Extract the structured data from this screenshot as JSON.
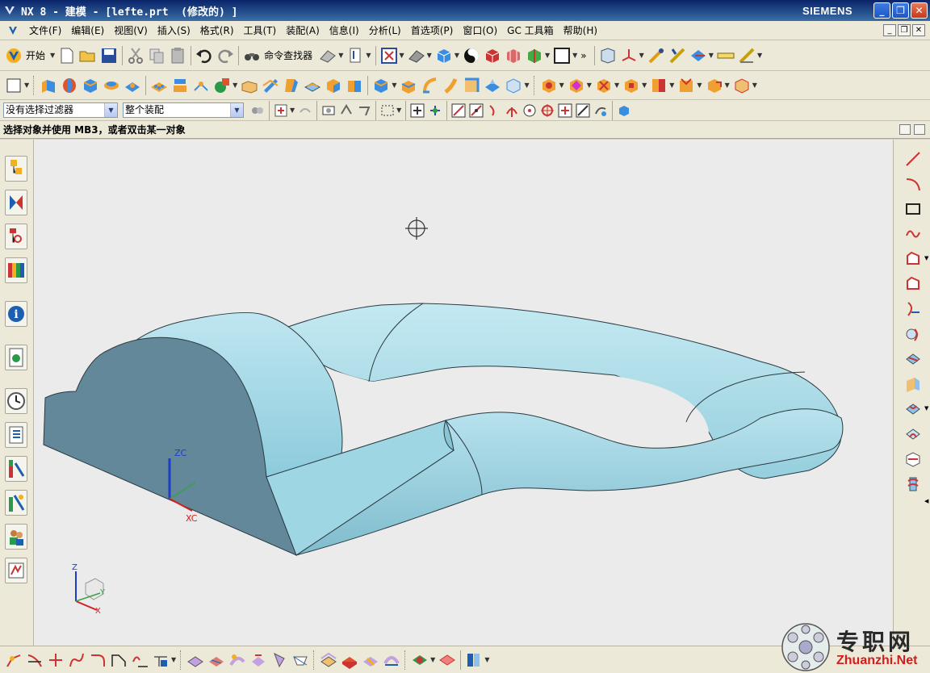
{
  "window": {
    "title": "NX 8 - 建模 - [lefte.prt  (修改的) ]",
    "brand": "SIEMENS",
    "minimize": "_",
    "maximize": "❐",
    "close": "✕"
  },
  "menu": {
    "items": [
      "文件(F)",
      "编辑(E)",
      "视图(V)",
      "插入(S)",
      "格式(R)",
      "工具(T)",
      "装配(A)",
      "信息(I)",
      "分析(L)",
      "首选项(P)",
      "窗口(O)",
      "GC 工具箱",
      "帮助(H)"
    ]
  },
  "toolbar": {
    "start_label": "开始",
    "command_finder_label": "命令查找器",
    "overflow": "»"
  },
  "selection": {
    "filter_value": "没有选择过滤器",
    "scope_value": "整个装配"
  },
  "prompt": {
    "text": "选择对象并使用 MB3，或者双击某一对象"
  },
  "viewport": {
    "wcs_z": "ZC",
    "wcs_x": "XC",
    "triad_z": "Z",
    "triad_x": "X",
    "triad_y": "Y",
    "model_color": "#a9dbe8"
  },
  "watermark": {
    "cn": "专职网",
    "en": "Zhuanzhi.Net"
  }
}
